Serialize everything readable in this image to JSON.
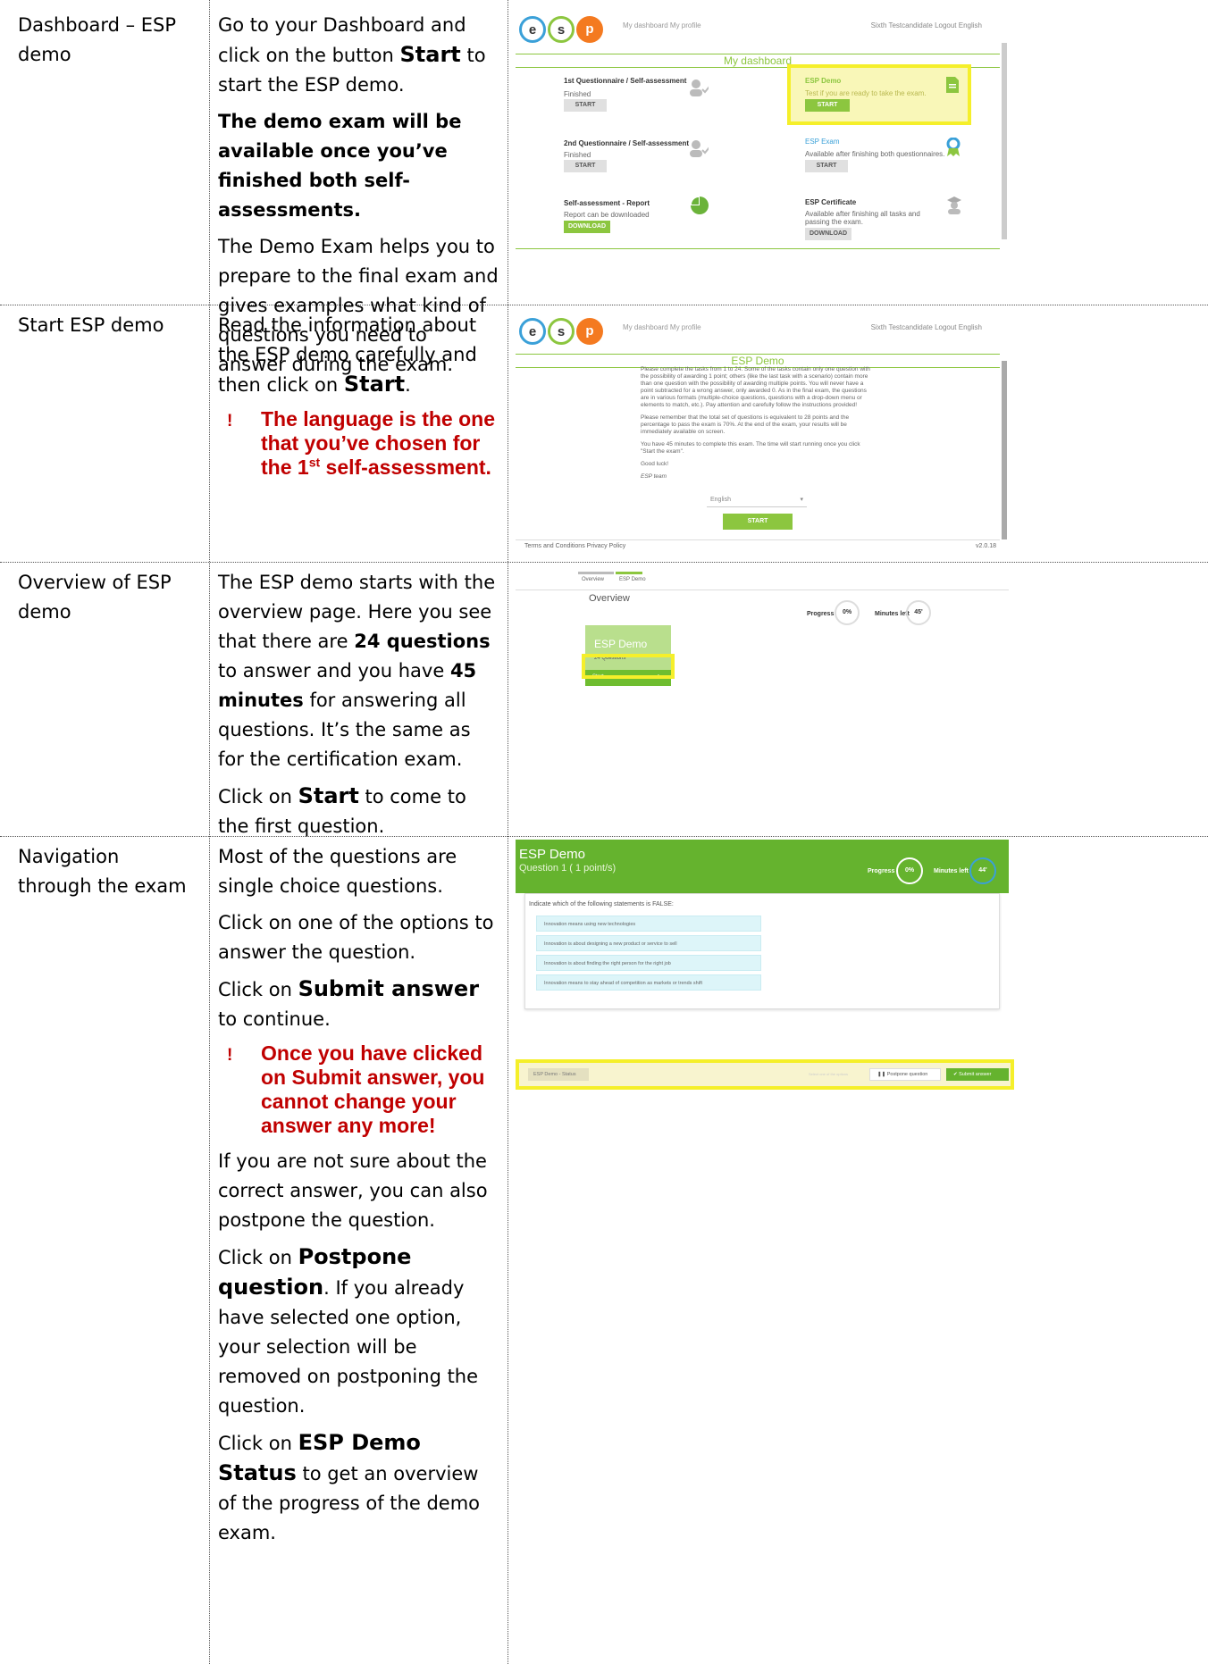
{
  "rows": [
    {
      "step": "Dashboard – ESP demo",
      "p1_pre": "Go to your Dashboard and click on the button ",
      "p1_bold": "Start",
      "p1_post": " to start the ESP demo.",
      "p2_bold": "The demo exam will be available once you’ve finished both self-assessments.",
      "p3": "The Demo Exam helps you to prepare to the final exam and gives examples what kind of questions you need to answer during the exam."
    },
    {
      "step": "Start ESP demo",
      "p1_pre": "Read the information about the ESP demo carefully and then click on ",
      "p1_bold": "Start",
      "p1_post": ".",
      "warn_mark": "!",
      "warn_pre": "The language is the one that you’ve chosen for the 1",
      "warn_sup": "st",
      "warn_post": " self-assessment."
    },
    {
      "step": "Overview of ESP demo",
      "p1_a": "The ESP demo starts with the overview page. Here you see that there are ",
      "p1_b": "24 questions",
      "p1_c": " to answer and you have ",
      "p1_d": "45 minutes",
      "p1_e": " for answering all questions. It’s the same as for the certification exam.",
      "p2_pre": "Click on ",
      "p2_bold": "Start",
      "p2_post": " to come to the first question."
    },
    {
      "step": "Navigation through the exam",
      "p1": "Most of the questions are single choice questions.",
      "p2": "Click on one of the options to answer the question.",
      "p3_pre": "Click on ",
      "p3_bold": "Submit answer",
      "p3_post": " to continue.",
      "warn_mark": "!",
      "warn": "Once you have clicked on Submit answer, you cannot change your answer any more!",
      "p4": "If you are not sure about the correct answer, you can also postpone the question.",
      "p5_pre": "Click on ",
      "p5_bold": "Postpone question",
      "p5_post": ". If you already have selected one option, your selection will be removed on postponing the question.",
      "p6_pre": "Click on ",
      "p6_bold": "ESP Demo Status",
      "p6_post": " to get an overview of the progress of the demo exam."
    }
  ],
  "shot1": {
    "nav": "My dashboard   My profile",
    "user": "Sixth Testcandidate   Logout   English",
    "title": "My dashboard",
    "q1_title": "1st Questionnaire / Self-assessment",
    "q1_status": "Finished",
    "q2_title": "2nd Questionnaire / Self-assessment",
    "q2_status": "Finished",
    "report_title": "Self-assessment - Report",
    "report_status": "Report can be downloaded",
    "demo_title": "ESP Demo",
    "demo_status": "Test if you are ready to take the exam.",
    "exam_title": "ESP Exam",
    "exam_status": "Available after finishing both questionnaires.",
    "cert_title": "ESP Certificate",
    "cert_status": "Available after finishing all tasks and passing the exam.",
    "start": "START",
    "download": "DOWNLOAD"
  },
  "shot2": {
    "nav": "My dashboard   My profile",
    "user": "Sixth Testcandidate   Logout   English",
    "title": "ESP Demo",
    "text1": "Please complete the tasks from 1 to 24. Some of the tasks contain only one question with the possibility of awarding 1 point; others (like the last task with a scenario) contain more than one question with the possibility of awarding multiple points. You will never have a point subtracted for a wrong answer, only awarded 0. As in the final exam, the questions are in various formats (multiple-choice questions, questions with a drop-down menu or elements to match, etc.). Pay attention and carefully follow the instructions provided!",
    "text2": "Please remember that the total set of questions is equivalent to 28 points and the percentage to pass the exam is 70%. At the end of the exam, your results will be immediately available on screen.",
    "text3": "You have 45 minutes to complete this exam. The time will start running once you click \"Start the exam\".",
    "text4": "Good luck!",
    "text5": "ESP team",
    "language": "English",
    "start": "START",
    "footer_left": "Terms and Conditions    Privacy Policy",
    "version": "v2.0.18"
  },
  "shot3": {
    "tab1": "Overview",
    "tab2": "ESP Demo",
    "heading": "Overview",
    "progress_label": "Progress",
    "progress_value": "0%",
    "minutes_label": "Minutes left",
    "minutes_value": "45'",
    "card_title": "ESP Demo",
    "card_sub": "24 Questions",
    "start": "Start",
    "arrow": "▶"
  },
  "shot4": {
    "title": "ESP Demo",
    "subtitle": "Question 1 ( 1 point/s)",
    "progress_label": "Progress",
    "progress_value": "0%",
    "minutes_label": "Minutes left",
    "minutes_value": "44'",
    "question": "Indicate which of the following statements is FALSE:",
    "options": [
      "Innovation means using new technologies",
      "Innovation is about designing a new product or service to sell",
      "Innovation is about finding the right person for the right job",
      "Innovation means to stay ahead of competition as markets or trends shift"
    ],
    "status_btn": "ESP Demo - Status",
    "hint": "Select one of the options",
    "postpone": "Postpone question",
    "submit": "Submit answer"
  },
  "colors": {
    "brand_green": "#8cc63f",
    "highlight_yellow": "#f5ef2a",
    "warning_red": "#c00000"
  }
}
